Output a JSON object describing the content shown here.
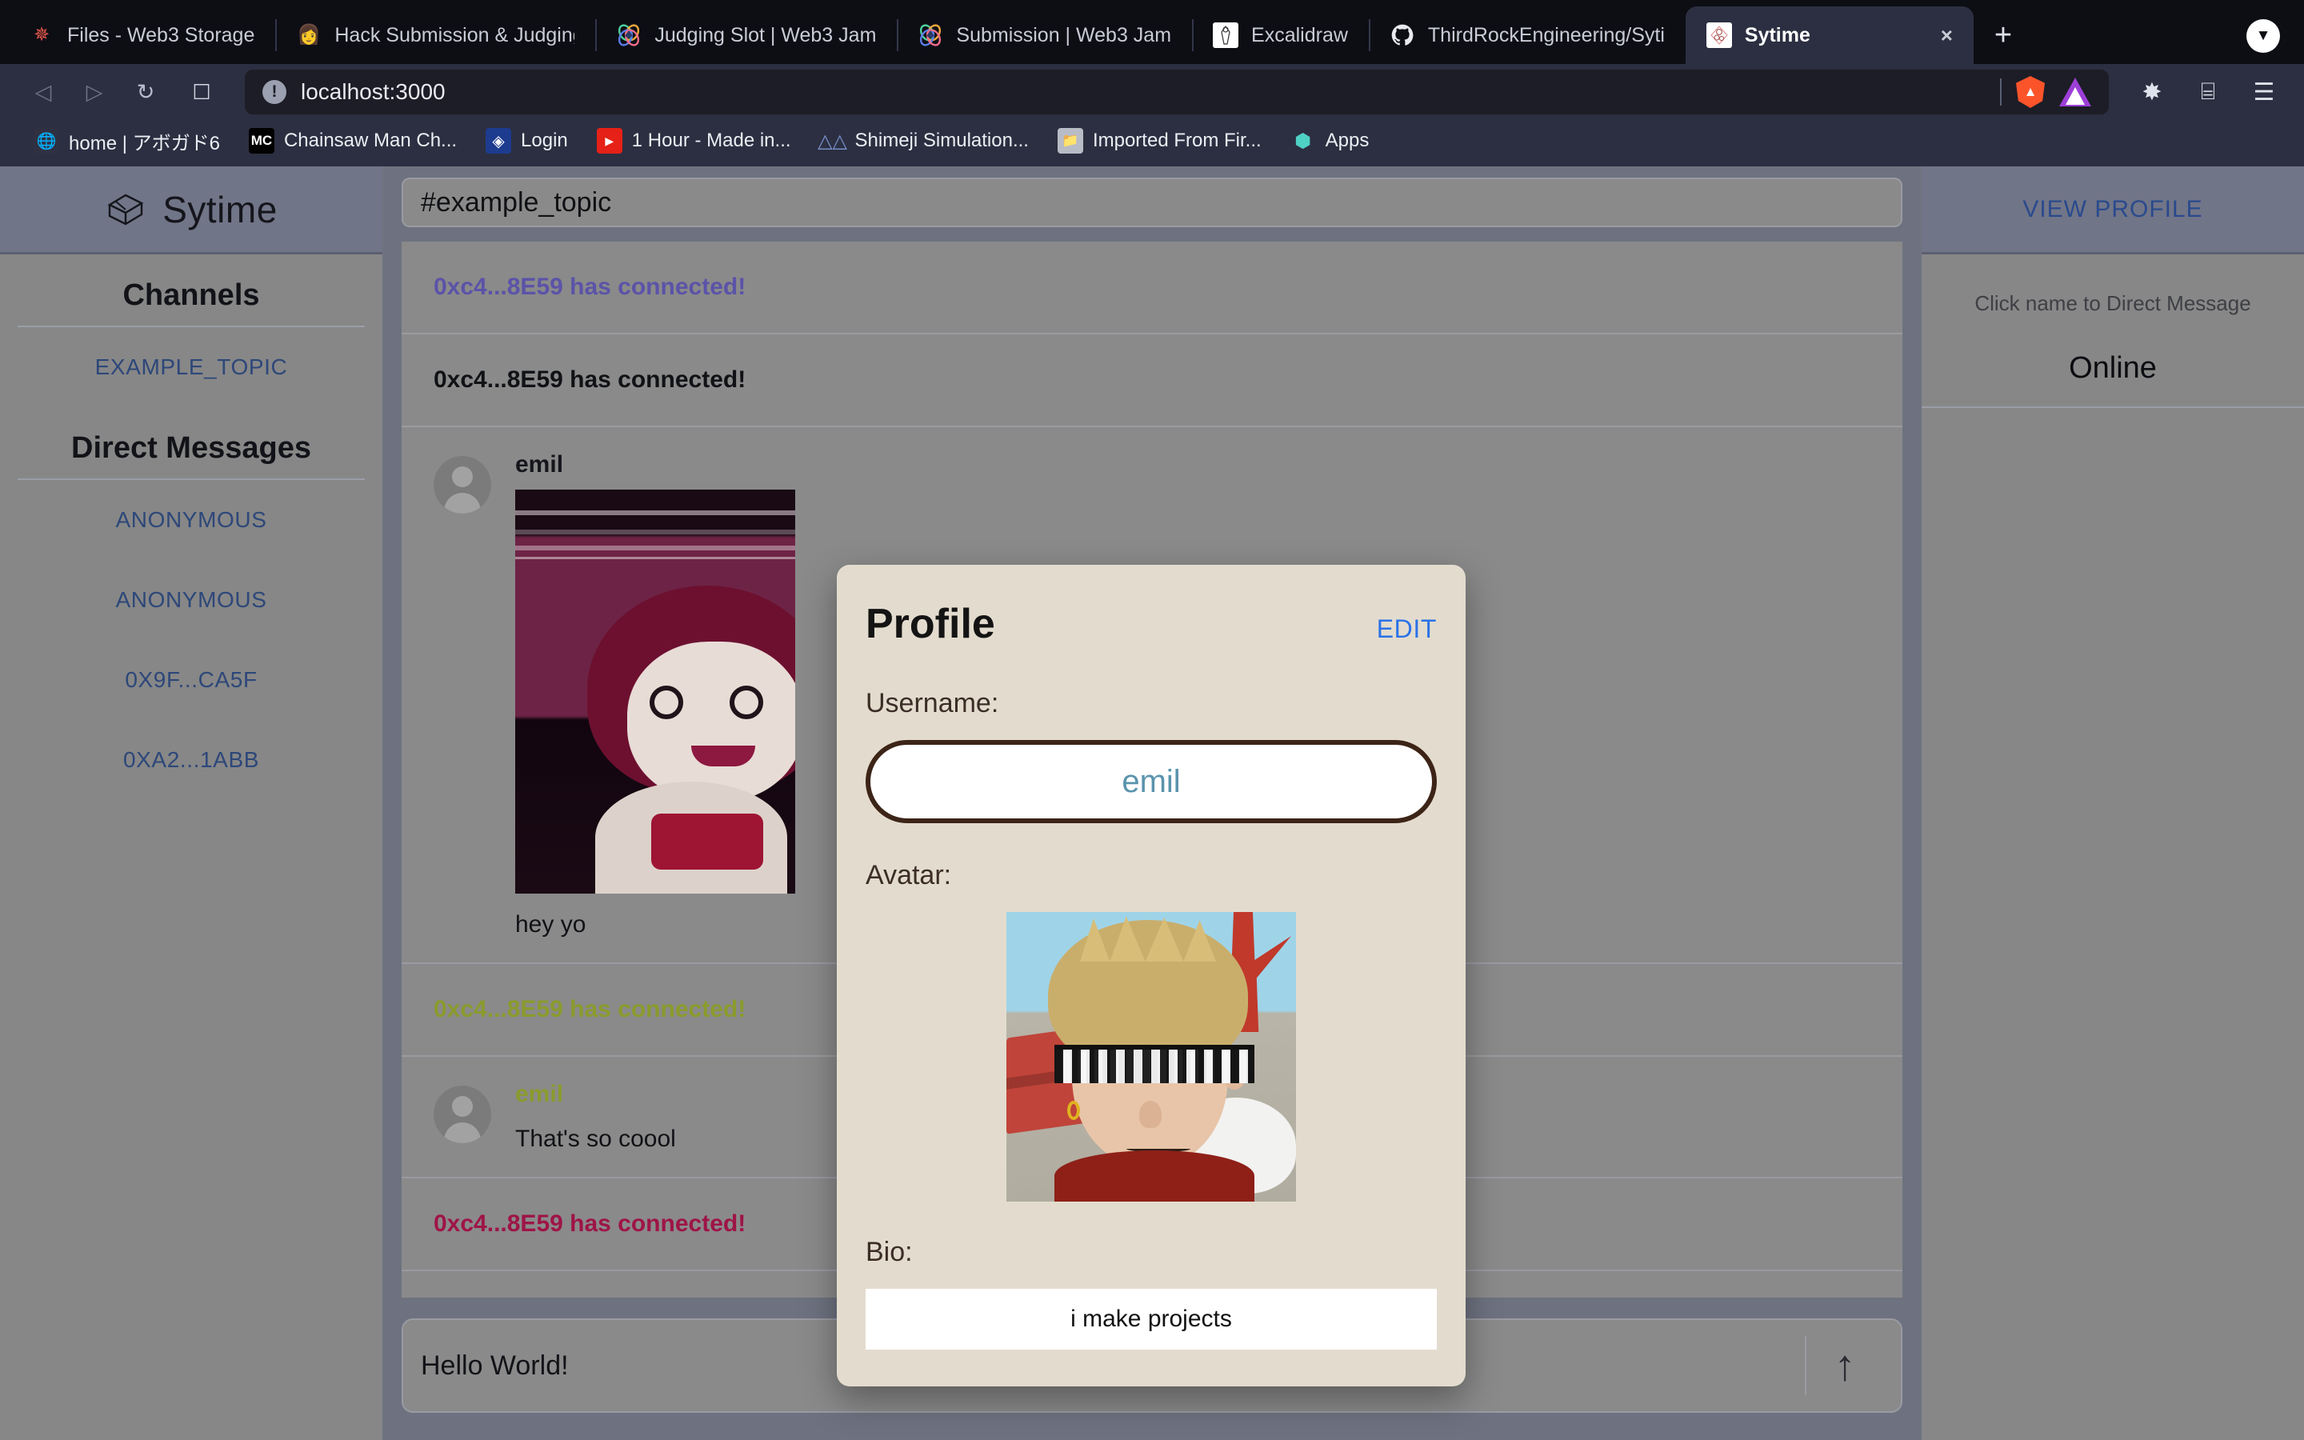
{
  "browser": {
    "tabs": [
      {
        "label": "Files - Web3 Storage",
        "icon": "asterisk-icon",
        "active": false
      },
      {
        "label": "Hack Submission & Judging",
        "icon": "person-icon",
        "active": false
      },
      {
        "label": "Judging Slot | Web3 Jam",
        "icon": "ethereum-icon",
        "active": false
      },
      {
        "label": "Submission | Web3 Jam",
        "icon": "ethereum-icon",
        "active": false
      },
      {
        "label": "Excalidraw",
        "icon": "excalidraw-icon",
        "active": false
      },
      {
        "label": "ThirdRockEngineering/Syti",
        "icon": "github-icon",
        "active": false
      },
      {
        "label": "Sytime",
        "icon": "sytime-icon",
        "active": true
      }
    ],
    "tab_close_label": "×",
    "new_tab_label": "+",
    "profile_chevron_label": "▼",
    "back_label": "◁",
    "forward_label": "▷",
    "reload_label": "↻",
    "bookmark_label": "☐",
    "url": {
      "host": "localhost",
      "path": ":3000",
      "security_icon_label": "!"
    },
    "extensions_label": "✸",
    "wallet_label": "⌸",
    "menu_label": "☰",
    "bookmarks": [
      {
        "label": "home | アボガド6",
        "icon": "globe-icon",
        "color": "#2a2a2a"
      },
      {
        "label": "Chainsaw Man Ch...",
        "icon": "mc-icon",
        "color": "#000000"
      },
      {
        "label": "Login",
        "icon": "shield-icon",
        "color": "#1d3b8f"
      },
      {
        "label": "1 Hour - Made in...",
        "icon": "youtube-icon",
        "color": "#e62117"
      },
      {
        "label": "Shimeji Simulation...",
        "icon": "shimeji-icon",
        "color": "#5d7bb8"
      },
      {
        "label": "Imported From Fir...",
        "icon": "folder-icon",
        "color": "#b8bcc6"
      },
      {
        "label": "Apps",
        "icon": "apps-icon",
        "color": "#4fd1c5"
      }
    ]
  },
  "app": {
    "brand": {
      "name": "Sytime",
      "logo": "cube-icon"
    },
    "sidebar": {
      "channels_title": "Channels",
      "channels": [
        {
          "label": "EXAMPLE_TOPIC"
        }
      ],
      "dm_title": "Direct Messages",
      "dms": [
        {
          "label": "ANONYMOUS"
        },
        {
          "label": "ANONYMOUS"
        },
        {
          "label": "0X9F...CA5F"
        },
        {
          "label": "0XA2...1ABB"
        }
      ]
    },
    "topic": {
      "value": "#example_topic"
    },
    "messages": [
      {
        "type": "system",
        "text": "0xc4...8E59 has connected!",
        "color": "#5b53a8"
      },
      {
        "type": "system",
        "text": "0xc4...8E59 has connected!",
        "color": "#101216"
      },
      {
        "type": "user",
        "author": "emil",
        "author_color": "#15161c",
        "text": "hey yo",
        "has_image": true
      },
      {
        "type": "system",
        "text": "0xc4...8E59 has connected!",
        "color": "#8a9a2c"
      },
      {
        "type": "user",
        "author": "emil",
        "author_color": "#8a9a2c",
        "text": "That's so coool",
        "has_image": false
      },
      {
        "type": "system",
        "text": "0xc4...8E59 has connected!",
        "color": "#9e1447"
      }
    ],
    "composer": {
      "value": "Hello World!",
      "send_icon": "↑"
    },
    "rightbar": {
      "view_profile": "VIEW PROFILE",
      "hint": "Click name to Direct Message",
      "online_title": "Online"
    },
    "modal": {
      "title": "Profile",
      "edit_label": "EDIT",
      "username_label": "Username:",
      "username_value": "emil",
      "avatar_label": "Avatar:",
      "avatar_icon": "user-avatar-image",
      "bio_label": "Bio:",
      "bio_value": "i make projects"
    }
  },
  "colors": {
    "modal_bg": "#e3dcce",
    "edit_blue": "#2a72e8",
    "link_blue": "#2d4779",
    "app_bg": "#8a8a8a",
    "panel_bg": "#6e7280"
  }
}
